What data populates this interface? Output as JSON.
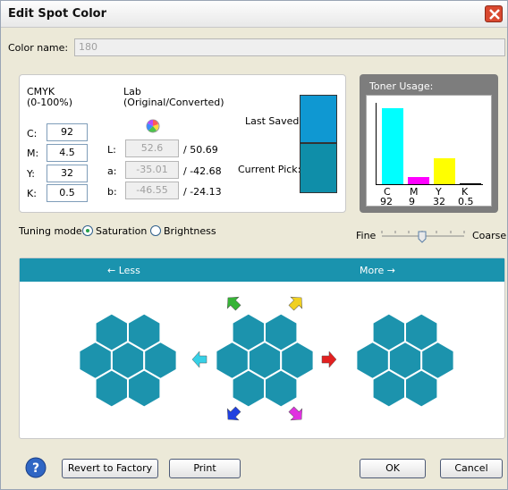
{
  "window": {
    "title": "Edit Spot Color"
  },
  "colorName": {
    "label": "Color name:",
    "value": "180"
  },
  "cmyk": {
    "header1": "CMYK",
    "header2": "(0-100%)",
    "C": {
      "label": "C:",
      "value": "92"
    },
    "M": {
      "label": "M:",
      "value": "4.5"
    },
    "Y": {
      "label": "Y:",
      "value": "32"
    },
    "K": {
      "label": "K:",
      "value": "0.5"
    }
  },
  "lab": {
    "header1": "Lab",
    "header2": "(Original/Converted)",
    "L": {
      "label": "L:",
      "original": "52.6",
      "converted": "/ 50.69"
    },
    "a": {
      "label": "a:",
      "original": "-35.01",
      "converted": "/ -42.68"
    },
    "b": {
      "label": "b:",
      "original": "-46.55",
      "converted": "/ -24.13"
    }
  },
  "swatches": {
    "lastSavedLabel": "Last Saved:",
    "currentPickLabel": "Current Pick:",
    "lastSavedColor": "#0f98d2",
    "currentPickColor": "#0f8ea9"
  },
  "toner": {
    "title": "Toner Usage:",
    "bars": [
      {
        "label": "C",
        "value": "92",
        "color": "#00ffff"
      },
      {
        "label": "M",
        "value": "9",
        "color": "#ff00ff"
      },
      {
        "label": "Y",
        "value": "32",
        "color": "#ffff00"
      },
      {
        "label": "K",
        "value": "0.5",
        "color": "#000000"
      }
    ]
  },
  "tuning": {
    "label": "Tuning mode:",
    "saturation": "Saturation",
    "brightness": "Brightness",
    "selected": "Saturation"
  },
  "step": {
    "fine": "Fine",
    "coarse": "Coarse"
  },
  "banner": {
    "less": "← Less",
    "more": "More →"
  },
  "colors": {
    "hexBase": "#1c93ad",
    "hexDark": "#1287a2",
    "hexBorder": "#ffffff",
    "banner": "#1a93ae"
  },
  "footer": {
    "revert": "Revert to Factory",
    "print": "Print",
    "ok": "OK",
    "cancel": "Cancel"
  }
}
